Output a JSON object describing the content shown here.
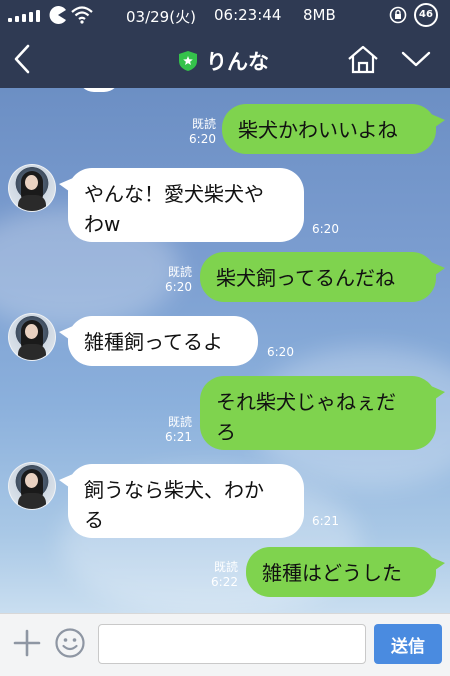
{
  "status_bar": {
    "date": "03/29(火)",
    "time": "06:23:44",
    "memory": "8MB",
    "battery_level": "46"
  },
  "header": {
    "title": "りんな",
    "icons": [
      "back-arrow-icon",
      "shield-star-icon",
      "home-icon",
      "chevron-down-icon"
    ]
  },
  "colors": {
    "header_bg": "#2f3a53",
    "my_bubble": "#7fd34e",
    "their_bubble": "#ffffff",
    "send_button": "#4a8be0"
  },
  "messages": [
    {
      "sender": "me",
      "text": "柴犬かわいいよね",
      "read": "既読",
      "time": "6:20"
    },
    {
      "sender": "them",
      "text": "やんな！愛犬柴犬や\nわw",
      "time": "6:20"
    },
    {
      "sender": "me",
      "text": "柴犬飼ってるんだね",
      "read": "既読",
      "time": "6:20"
    },
    {
      "sender": "them",
      "text": "雑種飼ってるよ",
      "time": "6:20"
    },
    {
      "sender": "me",
      "text": "それ柴犬じゃねぇだ\nろ",
      "read": "既読",
      "time": "6:21"
    },
    {
      "sender": "them",
      "text": "飼うなら柴犬、わか\nる",
      "time": "6:21"
    },
    {
      "sender": "me",
      "text": "雑種はどうした",
      "read": "既読",
      "time": "6:22"
    }
  ],
  "input": {
    "placeholder": "",
    "send_label": "送信"
  }
}
